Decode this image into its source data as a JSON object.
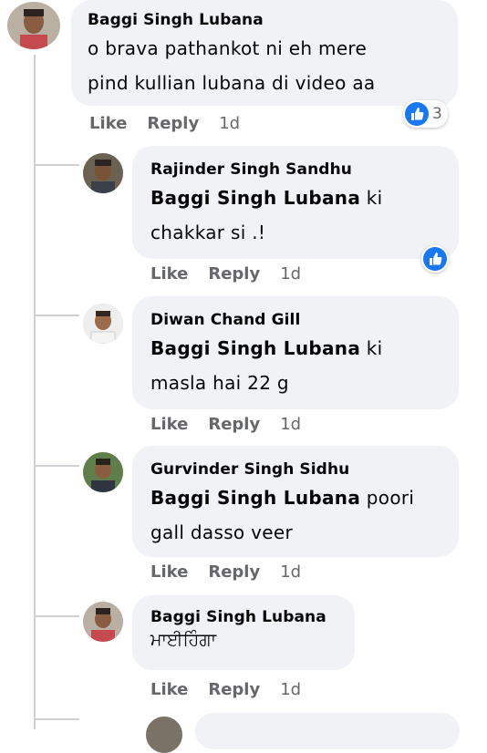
{
  "comments": [
    {
      "author": "Baggi Singh Lubana",
      "lines": [
        "o brava pathankot ni eh mere",
        "pind kullian lubana di video aa"
      ],
      "actions": {
        "like": "Like",
        "reply": "Reply",
        "time": "1d"
      },
      "reactions": {
        "icon": "like-icon",
        "count": "3"
      }
    },
    {
      "author": "Rajinder Singh Sandhu",
      "tag": "Baggi Singh Lubana",
      "line1_rest": " ki",
      "line2": "chakkar si .!",
      "actions": {
        "like": "Like",
        "reply": "Reply",
        "time": "1d"
      },
      "reactions": {
        "icon": "like-icon"
      }
    },
    {
      "author": "Diwan Chand Gill",
      "tag": "Baggi Singh Lubana",
      "line1_rest": " ki",
      "line2": "masla hai 22 g",
      "actions": {
        "like": "Like",
        "reply": "Reply",
        "time": "1d"
      }
    },
    {
      "author": "Gurvinder Singh Sidhu",
      "tag": "Baggi Singh Lubana",
      "line1_rest": " poori",
      "line2": "gall dasso veer",
      "actions": {
        "like": "Like",
        "reply": "Reply",
        "time": "1d"
      }
    },
    {
      "author": "Baggi Singh Lubana",
      "line1": "ਮਾਈਹਿੰਗਾ",
      "actions": {
        "like": "Like",
        "reply": "Reply",
        "time": "1d"
      }
    }
  ],
  "colors": {
    "bubble": "#f0f2f5",
    "like_blue": "#1877f2",
    "meta": "#65676b"
  }
}
